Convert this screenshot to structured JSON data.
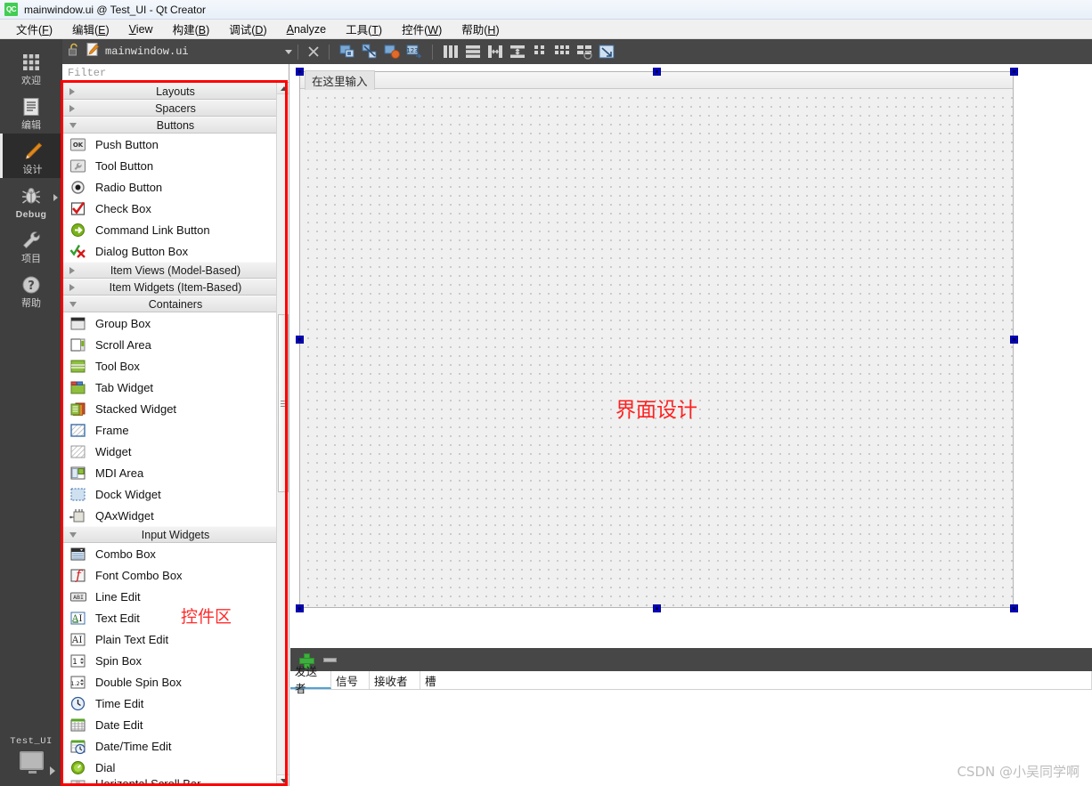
{
  "window": {
    "logo_text": "QC",
    "title": "mainwindow.ui @ Test_UI - Qt Creator"
  },
  "menubar": {
    "items": [
      {
        "label": "文件(F)",
        "mnemonic": "F",
        "icon": "menu-file"
      },
      {
        "label": "编辑(E)",
        "mnemonic": "E",
        "icon": "menu-edit"
      },
      {
        "label": "View",
        "mnemonic": "V",
        "icon": "menu-view"
      },
      {
        "label": "构建(B)",
        "mnemonic": "B",
        "icon": "menu-build"
      },
      {
        "label": "调试(D)",
        "mnemonic": "D",
        "icon": "menu-debug"
      },
      {
        "label": "Analyze",
        "mnemonic": "A",
        "icon": "menu-analyze"
      },
      {
        "label": "工具(T)",
        "mnemonic": "T",
        "icon": "menu-tools"
      },
      {
        "label": "控件(W)",
        "mnemonic": "W",
        "icon": "menu-window"
      },
      {
        "label": "帮助(H)",
        "mnemonic": "H",
        "icon": "menu-help"
      }
    ]
  },
  "modebar": {
    "items": [
      {
        "label": "欢迎",
        "icon": "grid-icon",
        "active": false,
        "has_arrow": false
      },
      {
        "label": "编辑",
        "icon": "document-icon",
        "active": false,
        "has_arrow": false
      },
      {
        "label": "设计",
        "icon": "pencil-icon",
        "active": true,
        "has_arrow": false
      },
      {
        "label": "Debug",
        "icon": "bug-icon",
        "active": false,
        "has_arrow": true
      },
      {
        "label": "项目",
        "icon": "wrench-icon",
        "active": false,
        "has_arrow": false
      },
      {
        "label": "帮助",
        "icon": "question-icon",
        "active": false,
        "has_arrow": false
      }
    ],
    "kit": {
      "name": "Test_UI",
      "icon": "monitor-icon"
    }
  },
  "toolstrip": {
    "lock_icon": "unlocked-icon",
    "file_icon": "ui-file-icon",
    "filename": "mainwindow.ui",
    "dropdown_icon": "chevron-down-icon",
    "close_icon": "close-icon",
    "designer_tools": [
      {
        "name": "edit-widgets",
        "title": "Edit Widgets"
      },
      {
        "name": "edit-signals-slots",
        "title": "Edit Signals/Slots"
      },
      {
        "name": "edit-buddies",
        "title": "Edit Buddies"
      },
      {
        "name": "edit-tab-order",
        "title": "Edit Tab Order"
      },
      {
        "name": "layout-horizontally",
        "title": "Lay Out Horizontally"
      },
      {
        "name": "layout-vertically",
        "title": "Lay Out Vertically"
      },
      {
        "name": "layout-splitter-horizontal",
        "title": "Lay Out Horizontally in Splitter"
      },
      {
        "name": "layout-splitter-vertical",
        "title": "Lay Out Vertically in Splitter"
      },
      {
        "name": "layout-form",
        "title": "Lay Out in a Form Layout"
      },
      {
        "name": "layout-grid",
        "title": "Lay Out in a Grid"
      },
      {
        "name": "break-layout",
        "title": "Break Layout"
      },
      {
        "name": "adjust-size",
        "title": "Adjust Size"
      }
    ]
  },
  "widgetbox": {
    "filter_placeholder": "Filter",
    "groups": [
      {
        "label": "Layouts",
        "expanded": false,
        "items": []
      },
      {
        "label": "Spacers",
        "expanded": false,
        "items": []
      },
      {
        "label": "Buttons",
        "expanded": true,
        "items": [
          {
            "label": "Push Button",
            "icon": "push-button-icon"
          },
          {
            "label": "Tool Button",
            "icon": "tool-button-icon"
          },
          {
            "label": "Radio Button",
            "icon": "radio-button-icon"
          },
          {
            "label": "Check Box",
            "icon": "check-box-icon"
          },
          {
            "label": "Command Link Button",
            "icon": "command-link-icon"
          },
          {
            "label": "Dialog Button Box",
            "icon": "dialog-button-box-icon"
          }
        ]
      },
      {
        "label": "Item Views (Model-Based)",
        "expanded": false,
        "items": []
      },
      {
        "label": "Item Widgets (Item-Based)",
        "expanded": false,
        "items": []
      },
      {
        "label": "Containers",
        "expanded": true,
        "items": [
          {
            "label": "Group Box",
            "icon": "group-box-icon"
          },
          {
            "label": "Scroll Area",
            "icon": "scroll-area-icon"
          },
          {
            "label": "Tool Box",
            "icon": "tool-box-icon"
          },
          {
            "label": "Tab Widget",
            "icon": "tab-widget-icon"
          },
          {
            "label": "Stacked Widget",
            "icon": "stacked-widget-icon"
          },
          {
            "label": "Frame",
            "icon": "frame-icon"
          },
          {
            "label": "Widget",
            "icon": "widget-icon"
          },
          {
            "label": "MDI Area",
            "icon": "mdi-area-icon"
          },
          {
            "label": "Dock Widget",
            "icon": "dock-widget-icon"
          },
          {
            "label": "QAxWidget",
            "icon": "qax-widget-icon"
          }
        ]
      },
      {
        "label": "Input Widgets",
        "expanded": true,
        "items": [
          {
            "label": "Combo Box",
            "icon": "combo-box-icon"
          },
          {
            "label": "Font Combo Box",
            "icon": "font-combo-box-icon"
          },
          {
            "label": "Line Edit",
            "icon": "line-edit-icon"
          },
          {
            "label": "Text Edit",
            "icon": "text-edit-icon"
          },
          {
            "label": "Plain Text Edit",
            "icon": "plain-text-edit-icon"
          },
          {
            "label": "Spin Box",
            "icon": "spin-box-icon"
          },
          {
            "label": "Double Spin Box",
            "icon": "double-spin-box-icon"
          },
          {
            "label": "Time Edit",
            "icon": "time-edit-icon"
          },
          {
            "label": "Date Edit",
            "icon": "date-edit-icon"
          },
          {
            "label": "Date/Time Edit",
            "icon": "date-time-edit-icon"
          },
          {
            "label": "Dial",
            "icon": "dial-icon"
          },
          {
            "label": "Horizontal Scroll Bar",
            "icon": "h-scroll-bar-icon"
          }
        ]
      }
    ]
  },
  "annotations": {
    "widgetbox_label": "控件区",
    "canvas_label": "界面设计",
    "border_color": "#ff0000",
    "text_color": "#ff2b2b"
  },
  "formeditor": {
    "menubar_placeholder": "在这里输入",
    "selection_handles": 8
  },
  "sigslot": {
    "add_label": "+",
    "remove_label": "−",
    "columns": [
      "发送者",
      "信号",
      "接收者",
      "槽"
    ],
    "rows": []
  },
  "watermark": {
    "text": "CSDN @小吴同学啊"
  }
}
